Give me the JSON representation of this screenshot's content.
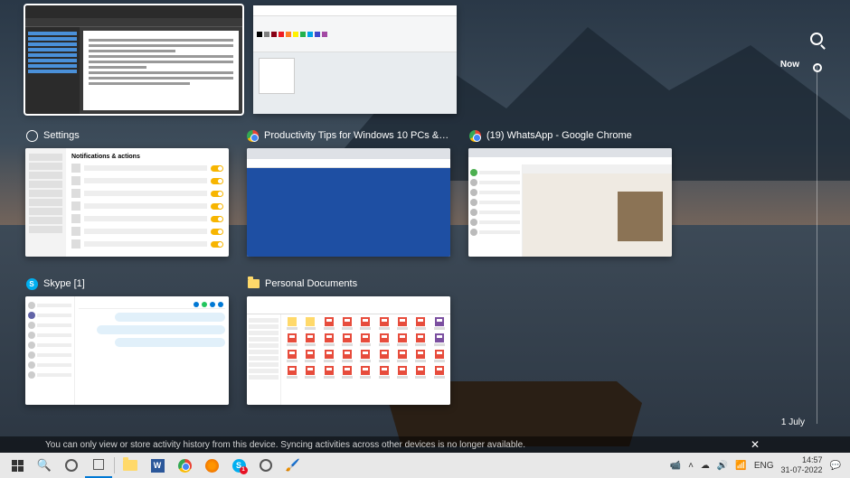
{
  "timeline": {
    "now": "Now",
    "date": "1 July"
  },
  "windows": {
    "settings": {
      "title": "Settings",
      "heading": "Notifications & actions"
    },
    "chrome1": {
      "title": "Productivity Tips for Windows 10 PCs &bull;..."
    },
    "chrome2": {
      "title": "(19) WhatsApp - Google Chrome"
    },
    "skype": {
      "title": "Skype [1]"
    },
    "explorer": {
      "title": "Personal Documents"
    }
  },
  "notice": {
    "text": "You can only view or store activity history from this device. Syncing activities across other devices is no longer available."
  },
  "taskbar": {
    "skype_badge": "1",
    "tray": {
      "chevron": "˄",
      "onedrive": "☁",
      "lang": "ENG",
      "time": "14:57",
      "date": "31-07-2022"
    }
  }
}
